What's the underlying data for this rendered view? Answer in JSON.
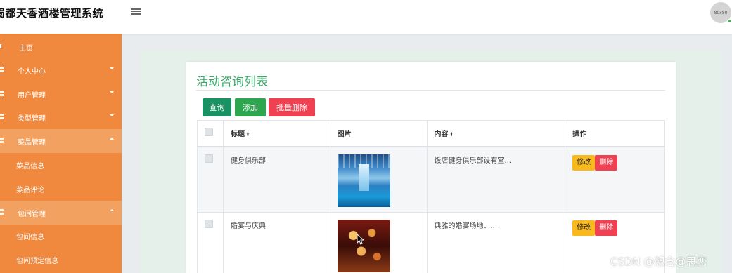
{
  "header": {
    "app_title": "蜀都天香酒楼管理系统",
    "avatar_text": "80x80"
  },
  "sidebar": {
    "items": [
      {
        "label": "主页"
      },
      {
        "label": "个人中心"
      },
      {
        "label": "用户管理"
      },
      {
        "label": "类型管理"
      },
      {
        "label": "菜品管理"
      },
      {
        "label": "包间管理"
      }
    ],
    "subitems": [
      {
        "label": "菜品信息"
      },
      {
        "label": "菜品评论"
      },
      {
        "label": "包间信息"
      },
      {
        "label": "包间预定信息"
      }
    ]
  },
  "main": {
    "title": "活动咨询列表",
    "buttons": {
      "query": "查询",
      "add": "添加",
      "batch_delete": "批量删除"
    },
    "table": {
      "headers": [
        "标题",
        "图片",
        "内容",
        "操作"
      ],
      "sort_marker": "⬍",
      "rows": [
        {
          "title": "健身俱乐部",
          "content": "饭店健身俱乐部设有室...",
          "edit": "修改",
          "delete": "删除"
        },
        {
          "title": "婚宴与庆典",
          "content": "典雅的婚宴场地、...",
          "edit": "修改",
          "delete": "删除"
        }
      ]
    }
  },
  "watermark": "CSDN @想念@思恋",
  "colors": {
    "sidebar": "#f0893d",
    "title_green": "#3aa86a",
    "btn_query": "#199263",
    "btn_add": "#2ea54f",
    "btn_delete": "#ef4151",
    "btn_edit": "#f8b91d"
  }
}
